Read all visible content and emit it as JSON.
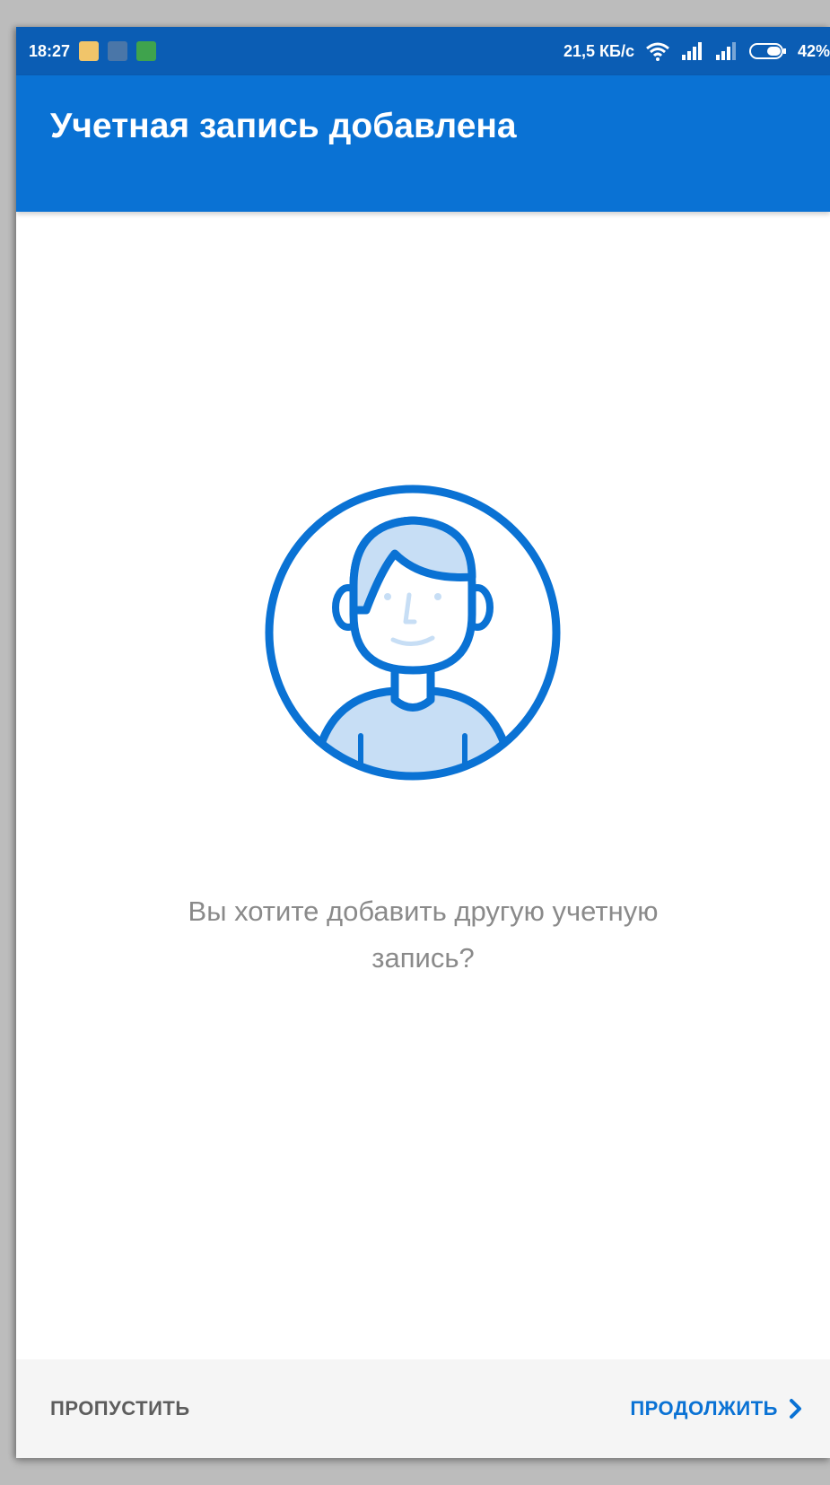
{
  "status_bar": {
    "time": "18:27",
    "network_speed": "21,5 КБ/с",
    "battery_percent": "42%",
    "notification_icons": [
      "calendar-icon",
      "vk-icon",
      "app-icon"
    ],
    "system_icons": [
      "wifi-icon",
      "signal-icon-1",
      "signal-icon-2",
      "battery-icon"
    ]
  },
  "toolbar": {
    "title": "Учетная запись добавлена"
  },
  "main": {
    "illustration": "user-avatar-icon",
    "question_line1": "Вы хотите добавить другую учетную",
    "question_line2": "запись?"
  },
  "bottom_bar": {
    "skip_label": "ПРОПУСТИТЬ",
    "continue_label": "ПРОДОЛЖИТЬ"
  },
  "colors": {
    "status_bar": "#0b5db4",
    "toolbar": "#0a72d4",
    "accent": "#0a72d4",
    "illustration_fill": "#c7def5",
    "question_text": "#8a8a8a",
    "bottom_bar": "#f5f5f5"
  }
}
